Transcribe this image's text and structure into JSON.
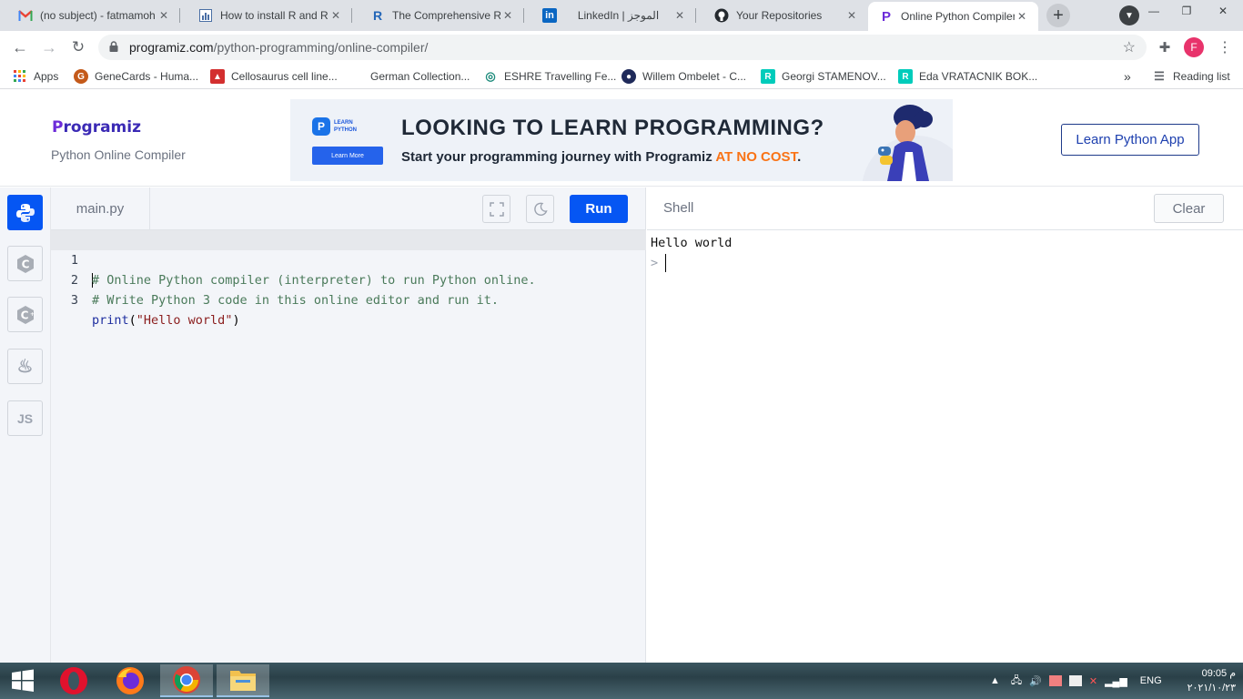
{
  "browser": {
    "tabs": [
      {
        "title": "(no subject) - fatmamoh",
        "icon": "gmail-icon",
        "close": "✕"
      },
      {
        "title": "How to install R and RStudio",
        "icon": "chart-icon",
        "close": "✕"
      },
      {
        "title": "The Comprehensive R Archive",
        "icon": "r-icon",
        "close": "✕"
      },
      {
        "title": "LinkedIn | الموجز",
        "icon": "linkedin-icon",
        "close": "✕"
      },
      {
        "title": "Your Repositories",
        "icon": "github-icon",
        "close": "✕"
      },
      {
        "title": "Online Python Compiler",
        "icon": "programiz-icon",
        "close": "✕"
      }
    ],
    "url_host": "programiz.com",
    "url_path": "/python-programming/online-compiler/",
    "profile_initial": "F",
    "bookmarks": [
      {
        "label": "Apps"
      },
      {
        "label": "GeneCards - Huma..."
      },
      {
        "label": "Cellosaurus cell line..."
      },
      {
        "label": "German Collection..."
      },
      {
        "label": "ESHRE Travelling Fe..."
      },
      {
        "label": "Willem Ombelet - C..."
      },
      {
        "label": "Georgi STAMENOV..."
      },
      {
        "label": "Eda VRATACNIK BOK..."
      }
    ],
    "more_bookmarks": "»",
    "reading_list": "Reading list"
  },
  "site": {
    "logo_first": "P",
    "logo_rest": "rogramiz",
    "subtitle": "Python Online Compiler",
    "learn_button": "Learn Python App",
    "banner": {
      "badge_line1": "LEARN",
      "badge_line2": "PYTHON",
      "learn_more": "Learn More",
      "headline": "LOOKING TO LEARN PROGRAMMING?",
      "sub_prefix": "Start your programming journey with Programiz ",
      "sub_accent": "AT NO COST",
      "sub_suffix": "."
    }
  },
  "rail": {
    "langs": [
      {
        "name": "python",
        "glyph": ""
      },
      {
        "name": "c",
        "glyph": "C"
      },
      {
        "name": "cpp",
        "glyph": "C"
      },
      {
        "name": "java",
        "glyph": "♨"
      },
      {
        "name": "js",
        "glyph": "JS"
      }
    ]
  },
  "editor": {
    "filename": "main.py",
    "run_label": "Run",
    "lines": [
      {
        "num": "1",
        "text": "# Online Python compiler (interpreter) to run Python online."
      },
      {
        "num": "2",
        "text": "# Write Python 3 code in this online editor and run it."
      },
      {
        "num": "3",
        "fn": "print",
        "open": "(",
        "str": "\"Hello world\"",
        "close": ")"
      }
    ]
  },
  "shell": {
    "title": "Shell",
    "clear_label": "Clear",
    "output": "Hello world",
    "prompt": ">"
  },
  "taskbar": {
    "lang": "ENG",
    "time": "09:05 م",
    "date": "٢٠٢١/١٠/٢٣"
  },
  "colors": {
    "accent_blue": "#0556f3",
    "brand_purple": "#6c2bd9",
    "cost_orange": "#f97316"
  }
}
